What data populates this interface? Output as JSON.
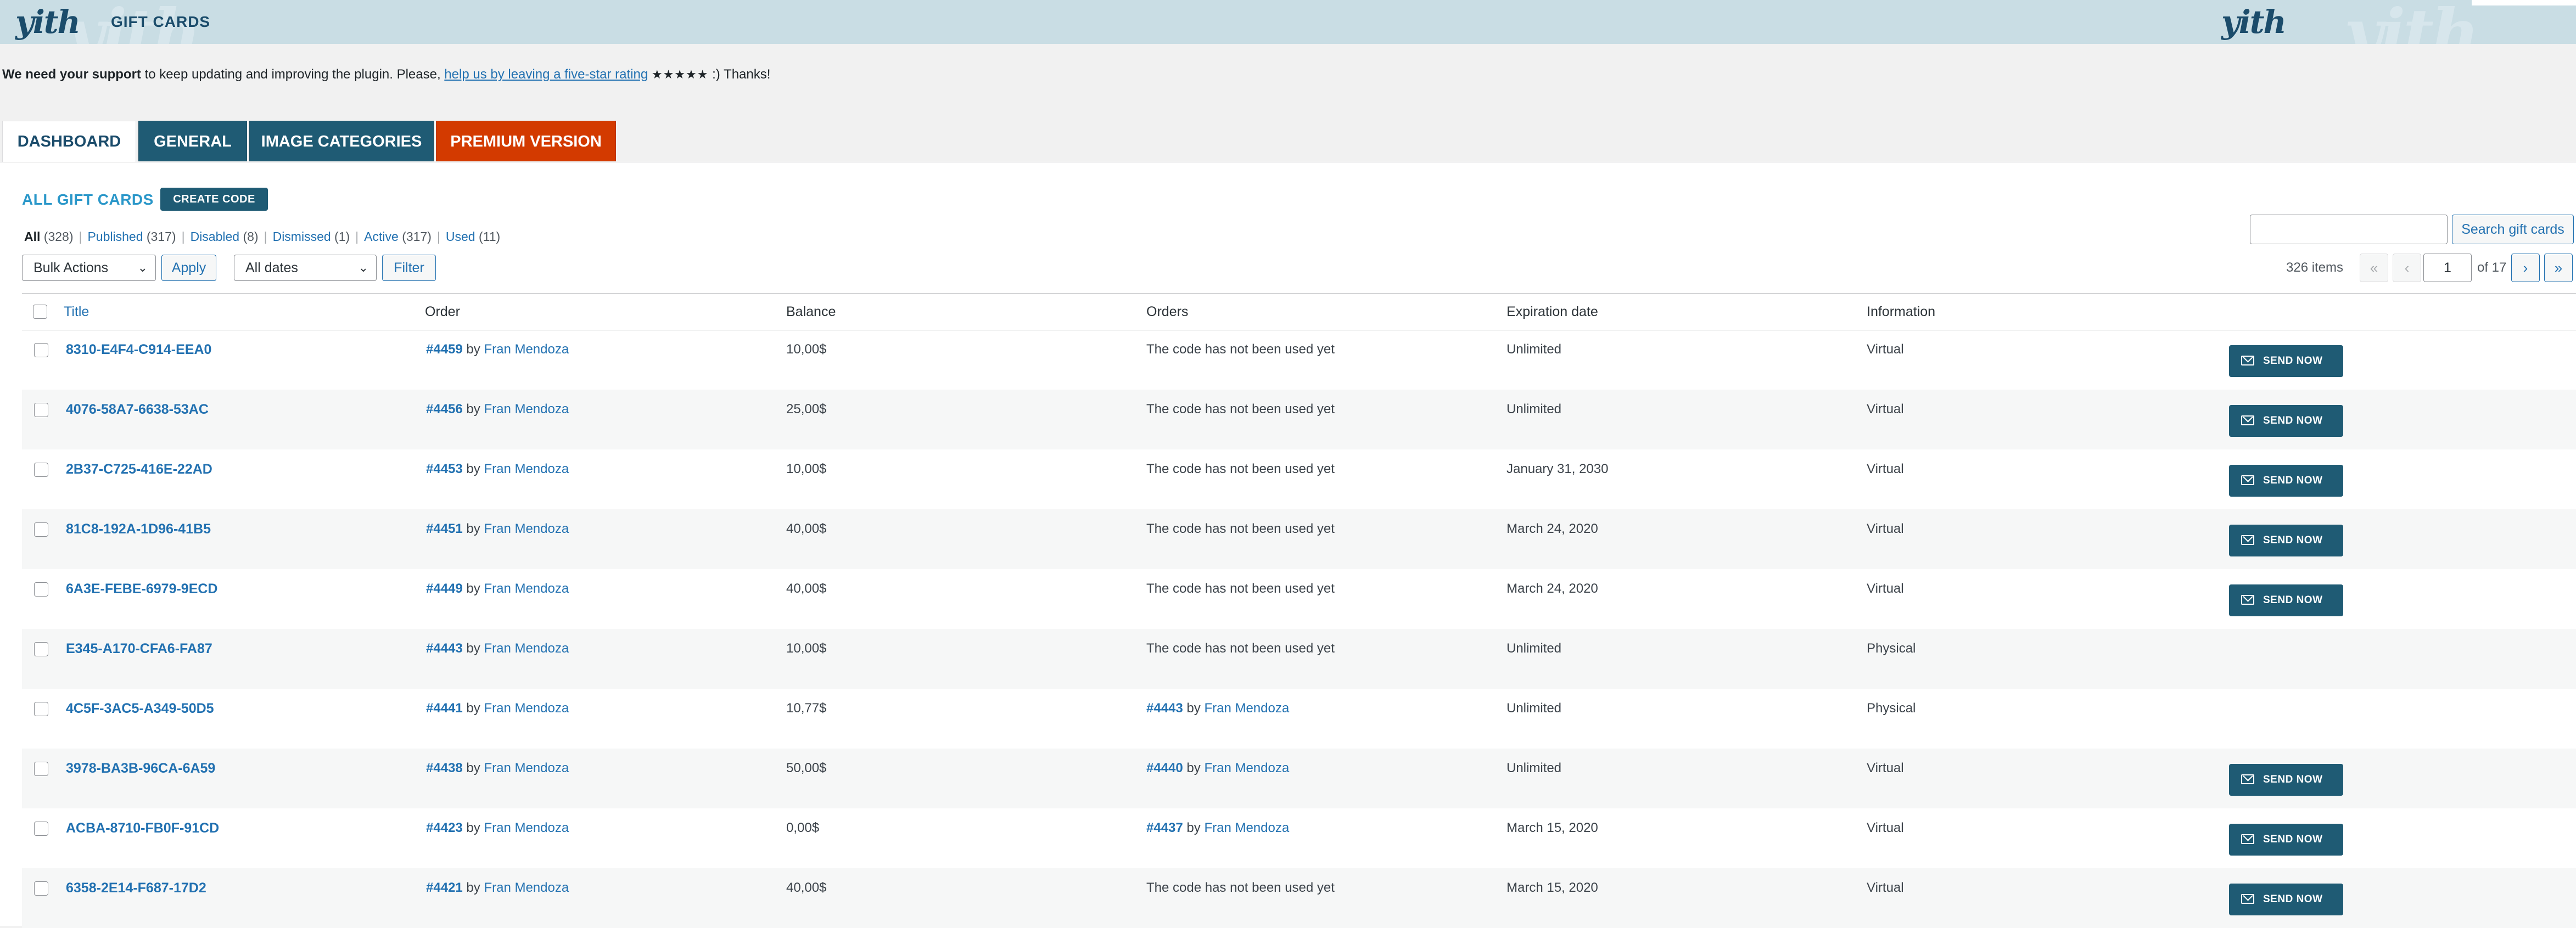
{
  "header": {
    "logo_text": "yith",
    "title": "GIFT CARDS"
  },
  "notice": {
    "bold": "We need your support",
    "text": " to keep updating and improving the plugin. Please, ",
    "link": "help us by leaving a five-star rating",
    "stars": "★★★★★",
    "end": " :) Thanks!"
  },
  "tabs": [
    {
      "label": "DASHBOARD",
      "active": true
    },
    {
      "label": "GENERAL"
    },
    {
      "label": "IMAGE CATEGORIES"
    },
    {
      "label": "PREMIUM VERSION"
    }
  ],
  "page": {
    "heading": "ALL GIFT CARDS",
    "create_button": "CREATE CODE"
  },
  "filters": {
    "all": {
      "label": "All",
      "count": "(328)"
    },
    "published": {
      "label": "Published",
      "count": "(317)"
    },
    "disabled": {
      "label": "Disabled",
      "count": "(8)"
    },
    "dismissed": {
      "label": "Dismissed",
      "count": "(1)"
    },
    "active": {
      "label": "Active",
      "count": "(317)"
    },
    "used": {
      "label": "Used",
      "count": "(11)"
    }
  },
  "toolbar": {
    "bulk_actions": "Bulk Actions",
    "apply": "Apply",
    "all_dates": "All dates",
    "filter": "Filter",
    "search_value": "",
    "search_button": "Search gift cards"
  },
  "pagination": {
    "items": "326 items",
    "first": "«",
    "prev": "‹",
    "current": "1",
    "of": "of 17",
    "next": "›",
    "last": "»"
  },
  "table": {
    "columns": [
      "Title",
      "Order",
      "Balance",
      "Orders",
      "Expiration date",
      "Information"
    ],
    "by_text": "by",
    "send_label": "SEND NOW",
    "rows": [
      {
        "code": "8310-E4F4-C914-EEA0",
        "order": "#4459",
        "customer": "Fran Mendoza",
        "balance": "10,00$",
        "orders_text": "The code has not been used yet",
        "expiration": "Unlimited",
        "info": "Virtual",
        "send": true
      },
      {
        "code": "4076-58A7-6638-53AC",
        "order": "#4456",
        "customer": "Fran Mendoza",
        "balance": "25,00$",
        "orders_text": "The code has not been used yet",
        "expiration": "Unlimited",
        "info": "Virtual",
        "send": true
      },
      {
        "code": "2B37-C725-416E-22AD",
        "order": "#4453",
        "customer": "Fran Mendoza",
        "balance": "10,00$",
        "orders_text": "The code has not been used yet",
        "expiration": "January 31, 2030",
        "info": "Virtual",
        "send": true
      },
      {
        "code": "81C8-192A-1D96-41B5",
        "order": "#4451",
        "customer": "Fran Mendoza",
        "balance": "40,00$",
        "orders_text": "The code has not been used yet",
        "expiration": "March 24, 2020",
        "info": "Virtual",
        "send": true
      },
      {
        "code": "6A3E-FEBE-6979-9ECD",
        "order": "#4449",
        "customer": "Fran Mendoza",
        "balance": "40,00$",
        "orders_text": "The code has not been used yet",
        "expiration": "March 24, 2020",
        "info": "Virtual",
        "send": true
      },
      {
        "code": "E345-A170-CFA6-FA87",
        "order": "#4443",
        "customer": "Fran Mendoza",
        "balance": "10,00$",
        "orders_text": "The code has not been used yet",
        "expiration": "Unlimited",
        "info": "Physical",
        "send": false
      },
      {
        "code": "4C5F-3AC5-A349-50D5",
        "order": "#4441",
        "customer": "Fran Mendoza",
        "balance": "10,77$",
        "orders_order": "#4443",
        "orders_customer": "Fran Mendoza",
        "expiration": "Unlimited",
        "info": "Physical",
        "send": false
      },
      {
        "code": "3978-BA3B-96CA-6A59",
        "order": "#4438",
        "customer": "Fran Mendoza",
        "balance": "50,00$",
        "orders_order": "#4440",
        "orders_customer": "Fran Mendoza",
        "expiration": "Unlimited",
        "info": "Virtual",
        "send": true
      },
      {
        "code": "ACBA-8710-FB0F-91CD",
        "order": "#4423",
        "customer": "Fran Mendoza",
        "balance": "0,00$",
        "orders_order": "#4437",
        "orders_customer": "Fran Mendoza",
        "expiration": "March 15, 2020",
        "info": "Virtual",
        "send": true
      },
      {
        "code": "6358-2E14-F687-17D2",
        "order": "#4421",
        "customer": "Fran Mendoza",
        "balance": "40,00$",
        "orders_text": "The code has not been used yet",
        "expiration": "March 15, 2020",
        "info": "Virtual",
        "send": true
      }
    ]
  }
}
